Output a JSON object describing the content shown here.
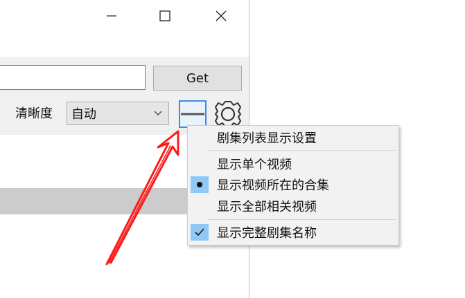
{
  "window": {
    "controls": {
      "minimize": "—",
      "maximize": "☐",
      "close": "✕"
    }
  },
  "toolbar": {
    "url_input_value": "",
    "get_label": "Get",
    "quality_label": "清晰度",
    "quality_selected": "自动"
  },
  "menu": {
    "items": [
      {
        "label": "剧集列表显示设置",
        "mark": ""
      },
      {
        "label": "显示单个视频",
        "mark": ""
      },
      {
        "label": "显示视频所在的合集",
        "mark": "bullet"
      },
      {
        "label": "显示全部相关视频",
        "mark": ""
      },
      {
        "label": "显示完整剧集名称",
        "mark": "check"
      }
    ]
  },
  "colors": {
    "accent": "#3a8ae8",
    "menu_mark_bg": "#90c8f6",
    "annotation_arrow": "#ff1a1a"
  },
  "icons": [
    "minimize-icon",
    "maximize-icon",
    "close-icon",
    "chevron-down-icon",
    "list-icon",
    "gear-icon",
    "bullet-icon",
    "check-icon"
  ]
}
